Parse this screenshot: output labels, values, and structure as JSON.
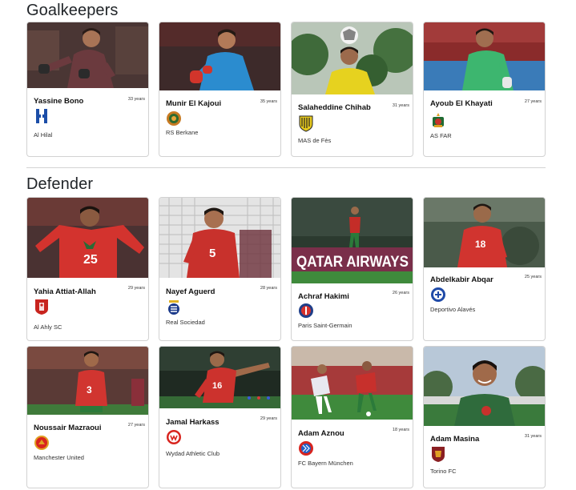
{
  "sections": {
    "goalkeepers": {
      "title": "Goalkeepers",
      "players": [
        {
          "name": "Yassine Bono",
          "age": "33 years",
          "club": "Al Hilal",
          "logo_icon": "al-hilal-logo-icon",
          "kit_color": "#6b3a3e"
        },
        {
          "name": "Munir El Kajoui",
          "age": "35 years",
          "club": "RS Berkane",
          "logo_icon": "rs-berkane-logo-icon",
          "kit_color": "#2b8ccf"
        },
        {
          "name": "Salaheddine Chihab",
          "age": "31 years",
          "club": "MAS de Fès",
          "logo_icon": "mas-fes-logo-icon",
          "kit_color": "#e6d21f"
        },
        {
          "name": "Ayoub El Khayati",
          "age": "27 years",
          "club": "AS FAR",
          "logo_icon": "as-far-logo-icon",
          "kit_color": "#3db66f"
        }
      ]
    },
    "defender": {
      "title": "Defender",
      "players": [
        {
          "name": "Yahia Attiat-Allah",
          "age": "29 years",
          "club": "Al Ahly SC",
          "logo_icon": "al-ahly-logo-icon",
          "kit_color": "#d3332e"
        },
        {
          "name": "Nayef Aguerd",
          "age": "28 years",
          "club": "Real Sociedad",
          "logo_icon": "real-sociedad-logo-icon",
          "kit_color": "#c8312c"
        },
        {
          "name": "Achraf Hakimi",
          "age": "26 years",
          "club": "Paris Saint-Germain",
          "logo_icon": "psg-logo-icon",
          "kit_color": "#c42d28"
        },
        {
          "name": "Abdelkabir Abqar",
          "age": "25 years",
          "club": "Deportivo Alavés",
          "logo_icon": "alaves-logo-icon",
          "kit_color": "#d1342f"
        },
        {
          "name": "Noussair Mazraoui",
          "age": "27 years",
          "club": "Manchester United",
          "logo_icon": "man-united-logo-icon",
          "kit_color": "#d13530"
        },
        {
          "name": "Jamal Harkass",
          "age": "29 years",
          "club": "Wydad Athletic Club",
          "logo_icon": "wydad-logo-icon",
          "kit_color": "#cc322d"
        },
        {
          "name": "Adam Aznou",
          "age": "18 years",
          "club": "FC Bayern München",
          "logo_icon": "bayern-logo-icon",
          "kit_color": "#c7302c"
        },
        {
          "name": "Adam Masina",
          "age": "31 years",
          "club": "Torino FC",
          "logo_icon": "torino-logo-icon",
          "kit_color": "#2f6b3c"
        }
      ]
    }
  },
  "banner_text": "QATAR AIRWAYS"
}
